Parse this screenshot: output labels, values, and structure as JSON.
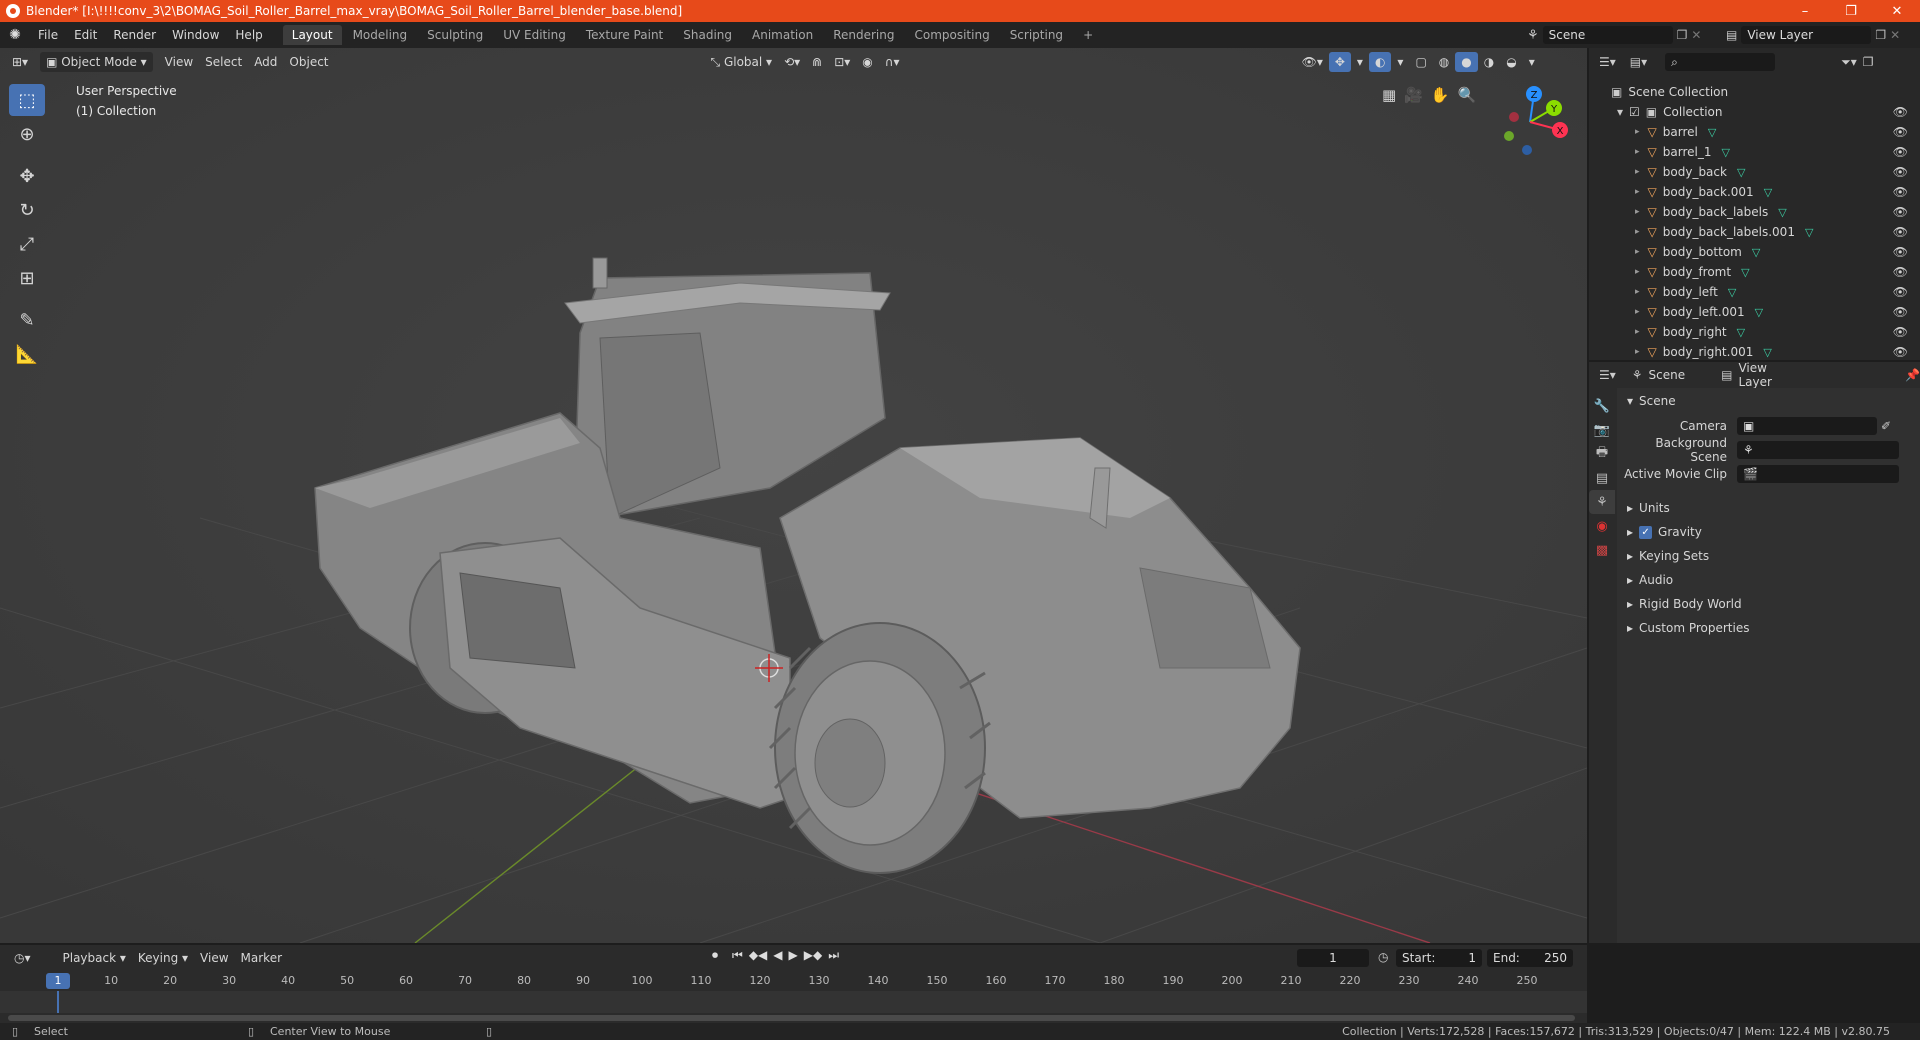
{
  "window": {
    "title": "Blender* [I:\\!!!!conv_3\\2\\BOMAG_Soil_Roller_Barrel_max_vray\\BOMAG_Soil_Roller_Barrel_blender_base.blend]",
    "minimize": "–",
    "maximize": "❐",
    "close": "✕"
  },
  "menu": {
    "items": [
      "File",
      "Edit",
      "Render",
      "Window",
      "Help"
    ],
    "workspaces": [
      "Layout",
      "Modeling",
      "Sculpting",
      "UV Editing",
      "Texture Paint",
      "Shading",
      "Animation",
      "Rendering",
      "Compositing",
      "Scripting"
    ],
    "active_workspace": 0,
    "add_tab": "+",
    "scene": "Scene",
    "view_layer": "View Layer"
  },
  "viewport": {
    "mode": "Object Mode",
    "menus": [
      "View",
      "Select",
      "Add",
      "Object"
    ],
    "transform_orientation": "Global",
    "overlay_line1": "User Perspective",
    "overlay_line2": "(1) Collection",
    "gizmo": {
      "z": "Z",
      "y": "Y",
      "x": "X"
    }
  },
  "outliner": {
    "search_placeholder": "",
    "scene_collection": "Scene Collection",
    "collection": "Collection",
    "objects": [
      "barrel",
      "barrel_1",
      "body_back",
      "body_back.001",
      "body_back_labels",
      "body_back_labels.001",
      "body_bottom",
      "body_fromt",
      "body_left",
      "body_left.001",
      "body_right",
      "body_right.001"
    ]
  },
  "properties": {
    "tab_scene": "Scene",
    "tab_view_layer": "View Layer",
    "section_title": "Scene",
    "camera_label": "Camera",
    "background_scene_label": "Background Scene",
    "active_movie_clip_label": "Active Movie Clip",
    "sections": [
      "Units",
      "Gravity",
      "Keying Sets",
      "Audio",
      "Rigid Body World",
      "Custom Properties"
    ],
    "gravity_checked": true
  },
  "timeline": {
    "menus": [
      "Playback",
      "Keying",
      "View",
      "Marker"
    ],
    "current_frame": "1",
    "start_label": "Start:",
    "start": "1",
    "end_label": "End:",
    "end": "250",
    "ticks": [
      1,
      10,
      20,
      30,
      40,
      50,
      60,
      70,
      80,
      90,
      100,
      110,
      120,
      130,
      140,
      150,
      160,
      170,
      180,
      190,
      200,
      210,
      220,
      230,
      240,
      250
    ]
  },
  "status": {
    "select": "Select",
    "center_view": "Center View to Mouse",
    "info": "Collection | Verts:172,528 | Faces:157,672 | Tris:313,529 | Objects:0/47 | Mem: 122.4 MB | v2.80.75"
  },
  "colors": {
    "titlebar": "#e74a1a",
    "accent": "#4772b3",
    "axis_x": "#ff3352",
    "axis_y": "#8bdc00",
    "axis_z": "#2890ff",
    "mesh_icon": "#3dd1a6",
    "object_icon": "#f0a45c"
  }
}
